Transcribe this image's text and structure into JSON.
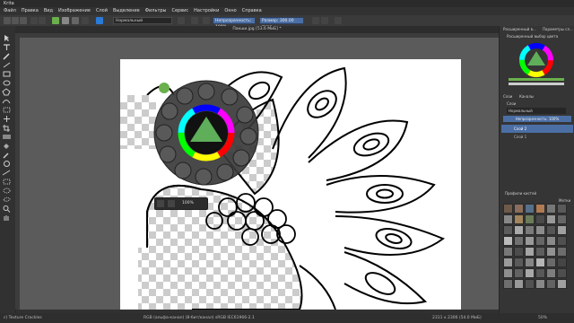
{
  "app": {
    "title": "Krita"
  },
  "menu": [
    "Файл",
    "Правка",
    "Вид",
    "Изображение",
    "Слой",
    "Выделение",
    "Фильтры",
    "Сервис",
    "Настройки",
    "Окно",
    "Справка"
  ],
  "toolbar": {
    "blend_mode": "Нормальный",
    "opacity_label": "Непрозрачность: 100%",
    "size_label": "Размер: 300.00 пикс"
  },
  "document": {
    "tab_title": "Пакши.jpg [53.6 MиБ] *"
  },
  "palette": {
    "zoom_label": "100%"
  },
  "docker": {
    "selector_tabs": [
      "Расширенный в...",
      "Параметры сл..."
    ],
    "selector_title": "Расширенный выбор цвета",
    "layers_tabs": [
      "Слои",
      "Каналы"
    ],
    "layers_label": "Слои",
    "layers_blend": "Нормальный",
    "layers_opacity": "Непрозрачность: 100%",
    "layers": [
      "Слой 2",
      "Слой 1"
    ],
    "presets_title": "Профили кистей",
    "presets_filter": "Метки"
  },
  "status": {
    "brush": "c) Texture Crackles",
    "color_info": "RGB (альфа-канал) (8-бит/канал)  sRGB IEC61966-2.1",
    "dims": "2311 x 2306 (54.0 MиБ)",
    "zoom": "50%"
  },
  "colors": {
    "accent": "#4b6fa5",
    "fg_color": "#6ab04c",
    "bg_color": "#ffffff",
    "selector_triangle": "#5fae5a"
  }
}
